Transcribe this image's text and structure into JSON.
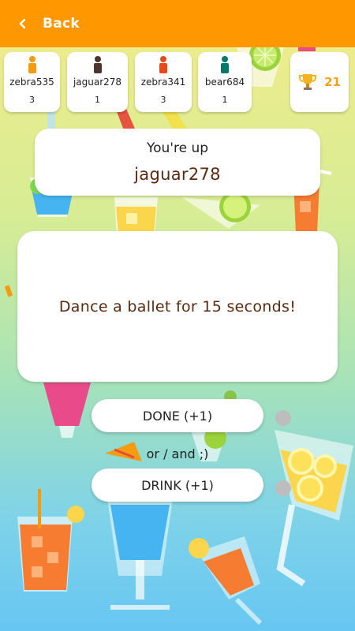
{
  "header": {
    "back_label": "Back",
    "background_color": "#ff9800"
  },
  "players": [
    {
      "name": "zebra535",
      "score": "3",
      "pawn_color": "#f39c12"
    },
    {
      "name": "jaguar278",
      "score": "1",
      "pawn_color": "#4e342e"
    },
    {
      "name": "zebra341",
      "score": "3",
      "pawn_color": "#e64a19"
    },
    {
      "name": "bear684",
      "score": "1",
      "pawn_color": "#00796b"
    }
  ],
  "trophy": {
    "icon": "trophy-icon",
    "score": "21",
    "color": "#f7a11a"
  },
  "turn": {
    "label": "You're up",
    "player": "jaguar278"
  },
  "task": {
    "text": "Dance a ballet for 15 seconds!"
  },
  "actions": {
    "done_label": "DONE (+1)",
    "or_label": "or / and ;)",
    "drink_label": "DRINK (+1)"
  }
}
